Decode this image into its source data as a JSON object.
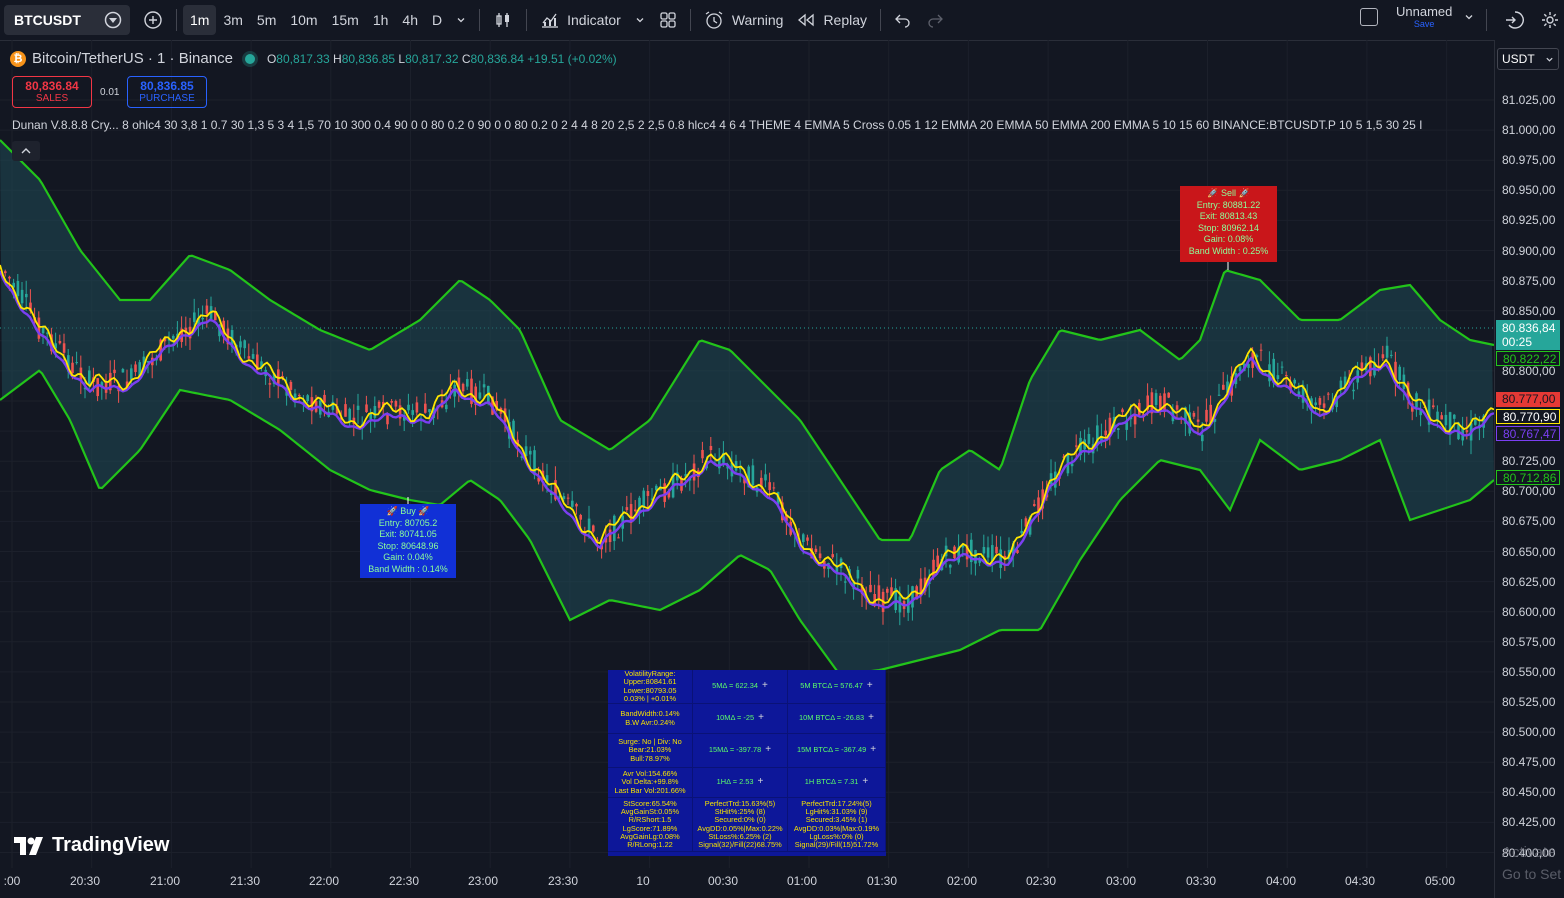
{
  "toolbar": {
    "symbol": "BTCUSDT",
    "timeframes": [
      "1m",
      "3m",
      "5m",
      "10m",
      "15m",
      "1h",
      "4h",
      "D"
    ],
    "active_timeframe": "1m",
    "indicator_label": "Indicator",
    "warning_label": "Warning",
    "replay_label": "Replay",
    "layout_name": "Unnamed",
    "layout_save": "Save"
  },
  "legend": {
    "title": "Bitcoin/TetherUS · 1 · Binance",
    "o_key": "O",
    "o_val": "80,817.33",
    "h_key": "H",
    "h_val": "80,836.85",
    "l_key": "L",
    "l_val": "80,817.32",
    "c_key": "C",
    "c_val": "80,836.84",
    "change": "+19.51 (+0.02%)"
  },
  "quote": {
    "sell_price": "80,836.84",
    "sell_label": "SALES",
    "spread": "0.01",
    "buy_price": "80,836.85",
    "buy_label": "PURCHASE"
  },
  "indicator_line": "Dunan V.8.8.8 Cry... 8 ohlc4 30 3,8 1 0.7 30 1,3 5 3 4 1,5 70 10 300 0.4 90 0 0 80 0.2 0 90 0 0 80 0.2 0 2 4 4 8 20 2,5 2 2,5 0.8 hlcc4 4 6 4 THEME 4 EMMA 5 Cross 0.05 1 12 EMMA 20 EMMA 50 EMMA 200 EMMA 5 10 15 60 BINANCE:BTCUSDT.P 10 5 1,5 30 25 I",
  "price_axis": {
    "currency": "USDT",
    "ticks": [
      "81.025,00",
      "81.000,00",
      "80.975,00",
      "80.950,00",
      "80.925,00",
      "80.900,00",
      "80.875,00",
      "80.850,00",
      "80.825,00",
      "80.800,00",
      "80.775,00",
      "80.750,00",
      "80.725,00",
      "80.700,00",
      "80.675,00",
      "80.650,00",
      "80.625,00",
      "80.600,00",
      "80.575,00",
      "80.550,00",
      "80.525,00",
      "80.500,00",
      "80.475,00",
      "80.450,00",
      "80.425,00",
      "80.400,00"
    ],
    "last_price": "80.836,84",
    "countdown": "00:25",
    "upper_band": "80.822,22",
    "red_level": "80.777,00",
    "yellow_level": "80.770,90",
    "purple_level": "80.767,47",
    "lower_band": "80.712,86"
  },
  "time_axis": [
    ":00",
    "20:30",
    "21:00",
    "21:30",
    "22:00",
    "22:30",
    "23:00",
    "23:30",
    "10",
    "00:30",
    "01:00",
    "01:30",
    "02:00",
    "02:30",
    "03:00",
    "03:30",
    "04:00",
    "04:30",
    "05:00"
  ],
  "buy_signal": {
    "title": "🚀 Buy 🚀",
    "entry": "Entry: 80705.2",
    "exit": "Exit: 80741.05",
    "stop": "Stop: 80648.96",
    "gain": "Gain: 0.04%",
    "band": "Band Width : 0.14%"
  },
  "sell_signal": {
    "title": "🚀 Sell 🚀",
    "entry": "Entry: 80881.22",
    "exit": "Exit: 80813.43",
    "stop": "Stop: 80962.14",
    "gain": "Gain: 0.08%",
    "band": "Band Width : 0.25%"
  },
  "stats": {
    "r1c1": [
      "VolatilityRange:",
      "Upper:80841.61",
      "Lower:80793.05",
      "0.03% | +0.01%"
    ],
    "r1c2": "5MΔ = 622.34",
    "r1c3": "5M BTCΔ = 576.47",
    "r2c1": [
      "BandWidth:0.14%",
      "B.W Avr:0.24%"
    ],
    "r2c2": "10MΔ = -25",
    "r2c3": "10M BTCΔ = -26.83",
    "r3c1": [
      "Surge: No | Div: No",
      "Bear:21.03%",
      "Bull:78.97%"
    ],
    "r3c2": "15MΔ = -397.78",
    "r3c3": "15M BTCΔ = -367.49",
    "r4c1": [
      "Avr Vol:154.66%",
      "Vol Delta:+99.8%",
      "Last Bar Vol:201.66%"
    ],
    "r4c2": "1HΔ = 2.53",
    "r4c3": "1H BTCΔ = 7.31",
    "r5c1": [
      "StScore:65.54%",
      "AvgGainSt:0.05%",
      "R/RShort:1.5",
      "LgScore:71.89%",
      "AvgGainLg:0.08%",
      "R/RLong:1.22"
    ],
    "r5c2": [
      "PerfectTrd:15.63%(5)",
      "StHit%:25% (8)",
      "Secured:0% (0)",
      "AvgDD:0.05%|Max:0.22%",
      "StLoss%:6.25% (2)",
      "Signal(32)/Fill(22)68.75%"
    ],
    "r5c3": [
      "PerfectTrd:17.24%(5)",
      "LgHit%:31.03% (9)",
      "Secured:3.45% (1)",
      "AvgDD:0.03%|Max:0.19%",
      "LgLoss%:0% (0)",
      "Signal(29)/Fill(15)51.72%"
    ]
  },
  "branding": "TradingView",
  "watermark": [
    "Activate",
    "Go to Set"
  ],
  "colors": {
    "bg": "#131722",
    "band": "#22c41a",
    "bull": "#26a69a",
    "bear": "#ef5350",
    "ema_fast": "#ffe600",
    "ema_slow": "#7b3ff2",
    "buy_box": "#1130d6",
    "sell_box": "#c9161a"
  }
}
